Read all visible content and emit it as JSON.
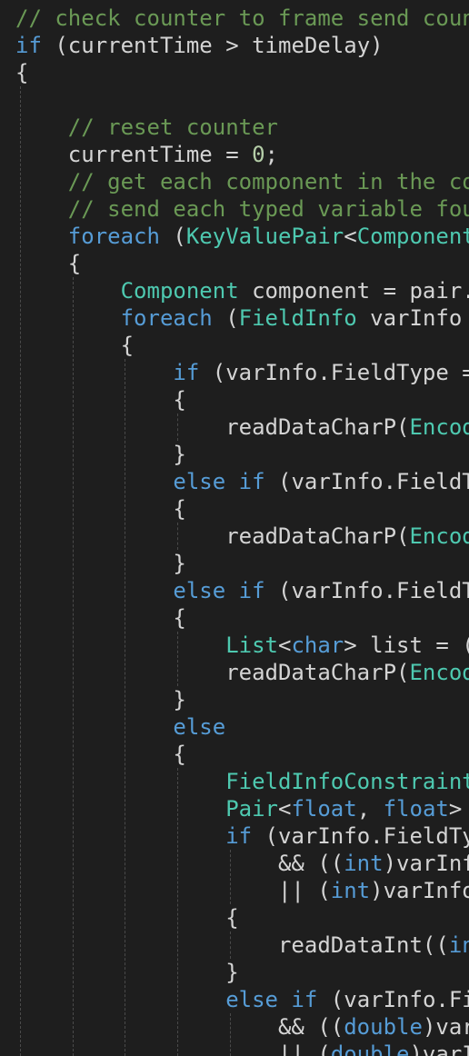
{
  "editor": {
    "language": "C#",
    "colors": {
      "background": "#1e1e1e",
      "text": "#d4d4d4",
      "comment": "#6a9955",
      "keyword": "#569cd6",
      "type": "#4ec9b0",
      "number": "#b5cea8",
      "function": "#dcdcaa",
      "indent_guide": "#4a4a4a"
    },
    "lines": [
      [
        [
          "cm",
          "// check counter to frame send count"
        ]
      ],
      [
        [
          "kw",
          "if"
        ],
        [
          "tx",
          " (currentTime > timeDelay)"
        ]
      ],
      [
        [
          "tx",
          "{"
        ]
      ],
      [],
      [
        [
          "tx",
          "    "
        ],
        [
          "cm",
          "// reset counter"
        ]
      ],
      [
        [
          "tx",
          "    currentTime = "
        ],
        [
          "nu",
          "0"
        ],
        [
          "tx",
          ";"
        ]
      ],
      [
        [
          "tx",
          "    "
        ],
        [
          "cm",
          "// get each component in the co"
        ]
      ],
      [
        [
          "tx",
          "    "
        ],
        [
          "cm",
          "// send each typed variable fou"
        ]
      ],
      [
        [
          "tx",
          "    "
        ],
        [
          "kw",
          "foreach"
        ],
        [
          "tx",
          " ("
        ],
        [
          "ty",
          "KeyValuePair"
        ],
        [
          "tx",
          "<"
        ],
        [
          "ty",
          "Component"
        ]
      ],
      [
        [
          "tx",
          "    {"
        ]
      ],
      [
        [
          "tx",
          "        "
        ],
        [
          "ty",
          "Component"
        ],
        [
          "tx",
          " component = pair."
        ]
      ],
      [
        [
          "tx",
          "        "
        ],
        [
          "kw",
          "foreach"
        ],
        [
          "tx",
          " ("
        ],
        [
          "ty",
          "FieldInfo"
        ],
        [
          "tx",
          " varInfo"
        ]
      ],
      [
        [
          "tx",
          "        {"
        ]
      ],
      [
        [
          "tx",
          "            "
        ],
        [
          "kw",
          "if"
        ],
        [
          "tx",
          " (varInfo.FieldType ="
        ]
      ],
      [
        [
          "tx",
          "            {"
        ]
      ],
      [
        [
          "tx",
          "                readDataCharP("
        ],
        [
          "ty",
          "Encod"
        ]
      ],
      [
        [
          "tx",
          "            }"
        ]
      ],
      [
        [
          "tx",
          "            "
        ],
        [
          "kw",
          "else if"
        ],
        [
          "tx",
          " (varInfo.FieldT"
        ]
      ],
      [
        [
          "tx",
          "            {"
        ]
      ],
      [
        [
          "tx",
          "                readDataCharP("
        ],
        [
          "ty",
          "Encod"
        ]
      ],
      [
        [
          "tx",
          "            }"
        ]
      ],
      [
        [
          "tx",
          "            "
        ],
        [
          "kw",
          "else if"
        ],
        [
          "tx",
          " (varInfo.FieldT"
        ]
      ],
      [
        [
          "tx",
          "            {"
        ]
      ],
      [
        [
          "tx",
          "                "
        ],
        [
          "ty",
          "List"
        ],
        [
          "tx",
          "<"
        ],
        [
          "kw",
          "char"
        ],
        [
          "tx",
          "> list = ("
        ]
      ],
      [
        [
          "tx",
          "                readDataCharP("
        ],
        [
          "ty",
          "Encod"
        ]
      ],
      [
        [
          "tx",
          "            }"
        ]
      ],
      [
        [
          "tx",
          "            "
        ],
        [
          "kw",
          "else"
        ]
      ],
      [
        [
          "tx",
          "            {"
        ]
      ],
      [
        [
          "tx",
          "                "
        ],
        [
          "ty",
          "FieldInfoConstraint"
        ]
      ],
      [
        [
          "tx",
          "                "
        ],
        [
          "ty",
          "Pair"
        ],
        [
          "tx",
          "<"
        ],
        [
          "kw",
          "float"
        ],
        [
          "tx",
          ", "
        ],
        [
          "kw",
          "float"
        ],
        [
          "tx",
          ">"
        ]
      ],
      [
        [
          "tx",
          "                "
        ],
        [
          "kw",
          "if"
        ],
        [
          "tx",
          " (varInfo.FieldTy"
        ]
      ],
      [
        [
          "tx",
          "                    && (("
        ],
        [
          "kw",
          "int"
        ],
        [
          "tx",
          ")varInf"
        ]
      ],
      [
        [
          "tx",
          "                    || ("
        ],
        [
          "kw",
          "int"
        ],
        [
          "tx",
          ")varInfo"
        ]
      ],
      [
        [
          "tx",
          "                {"
        ]
      ],
      [
        [
          "tx",
          "                    readDataInt(("
        ],
        [
          "kw",
          "in"
        ]
      ],
      [
        [
          "tx",
          "                }"
        ]
      ],
      [
        [
          "tx",
          "                "
        ],
        [
          "kw",
          "else if"
        ],
        [
          "tx",
          " (varInfo.Fi"
        ]
      ],
      [
        [
          "tx",
          "                    && (("
        ],
        [
          "kw",
          "double"
        ],
        [
          "tx",
          ")var"
        ]
      ],
      [
        [
          "tx",
          "                    || ("
        ],
        [
          "kw",
          "double"
        ],
        [
          "tx",
          ")varI"
        ]
      ]
    ]
  }
}
